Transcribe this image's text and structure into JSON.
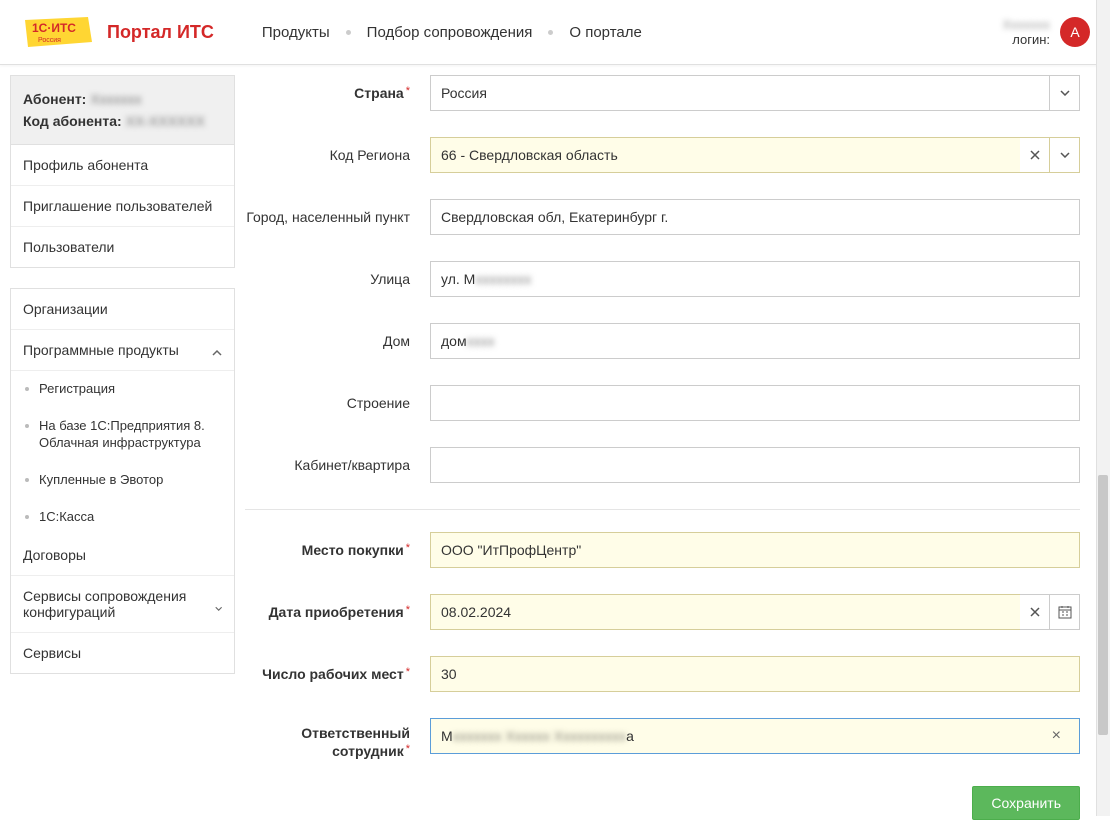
{
  "header": {
    "portal_title": "Портал ИТС",
    "nav": {
      "products": "Продукты",
      "support": "Подбор сопровождения",
      "about": "О портале"
    },
    "login_label": "логин:",
    "user_name": "Xxxxxxx",
    "avatar_letter": "A"
  },
  "sidebar": {
    "abonent_label": "Абонент:",
    "abonent_value": "Xxxxxxx",
    "abonent_code_label": "Код абонента:",
    "abonent_code_value": "XX-XXXXXX",
    "menu1": {
      "profile": "Профиль абонента",
      "invite": "Приглашение пользователей",
      "users": "Пользователи"
    },
    "menu2": {
      "orgs": "Организации",
      "products": "Программные продукты",
      "sub": {
        "registration": "Регистрация",
        "cloud": "На базе 1С:Предприятия 8. Облачная инфраструктура",
        "evotor": "Купленные в Эвотор",
        "kassa": "1С:Касса"
      },
      "contracts": "Договоры",
      "services": "Сервисы сопровождения конфигураций",
      "services2": "Сервисы"
    }
  },
  "form": {
    "country_label": "Страна",
    "country_value": "Россия",
    "region_label": "Код Региона",
    "region_value": "66 - Свердловская область",
    "city_label": "Город, населенный пункт",
    "city_value": "Свердловская обл, Екатеринбург г.",
    "street_label": "Улица",
    "street_value": "ул. М",
    "house_label": "Дом",
    "house_value": "дом",
    "building_label": "Строение",
    "building_value": "",
    "apt_label": "Кабинет/квартира",
    "apt_value": "",
    "purchase_place_label": "Место покупки",
    "purchase_place_value": "ООО \"ИтПрофЦентр\"",
    "purchase_date_label": "Дата приобретения",
    "purchase_date_value": "08.02.2024",
    "workplaces_label": "Число рабочих мест",
    "workplaces_value": "30",
    "responsible_label": "Ответственный сотрудник",
    "responsible_value": "М                              а",
    "save": "Сохранить"
  }
}
